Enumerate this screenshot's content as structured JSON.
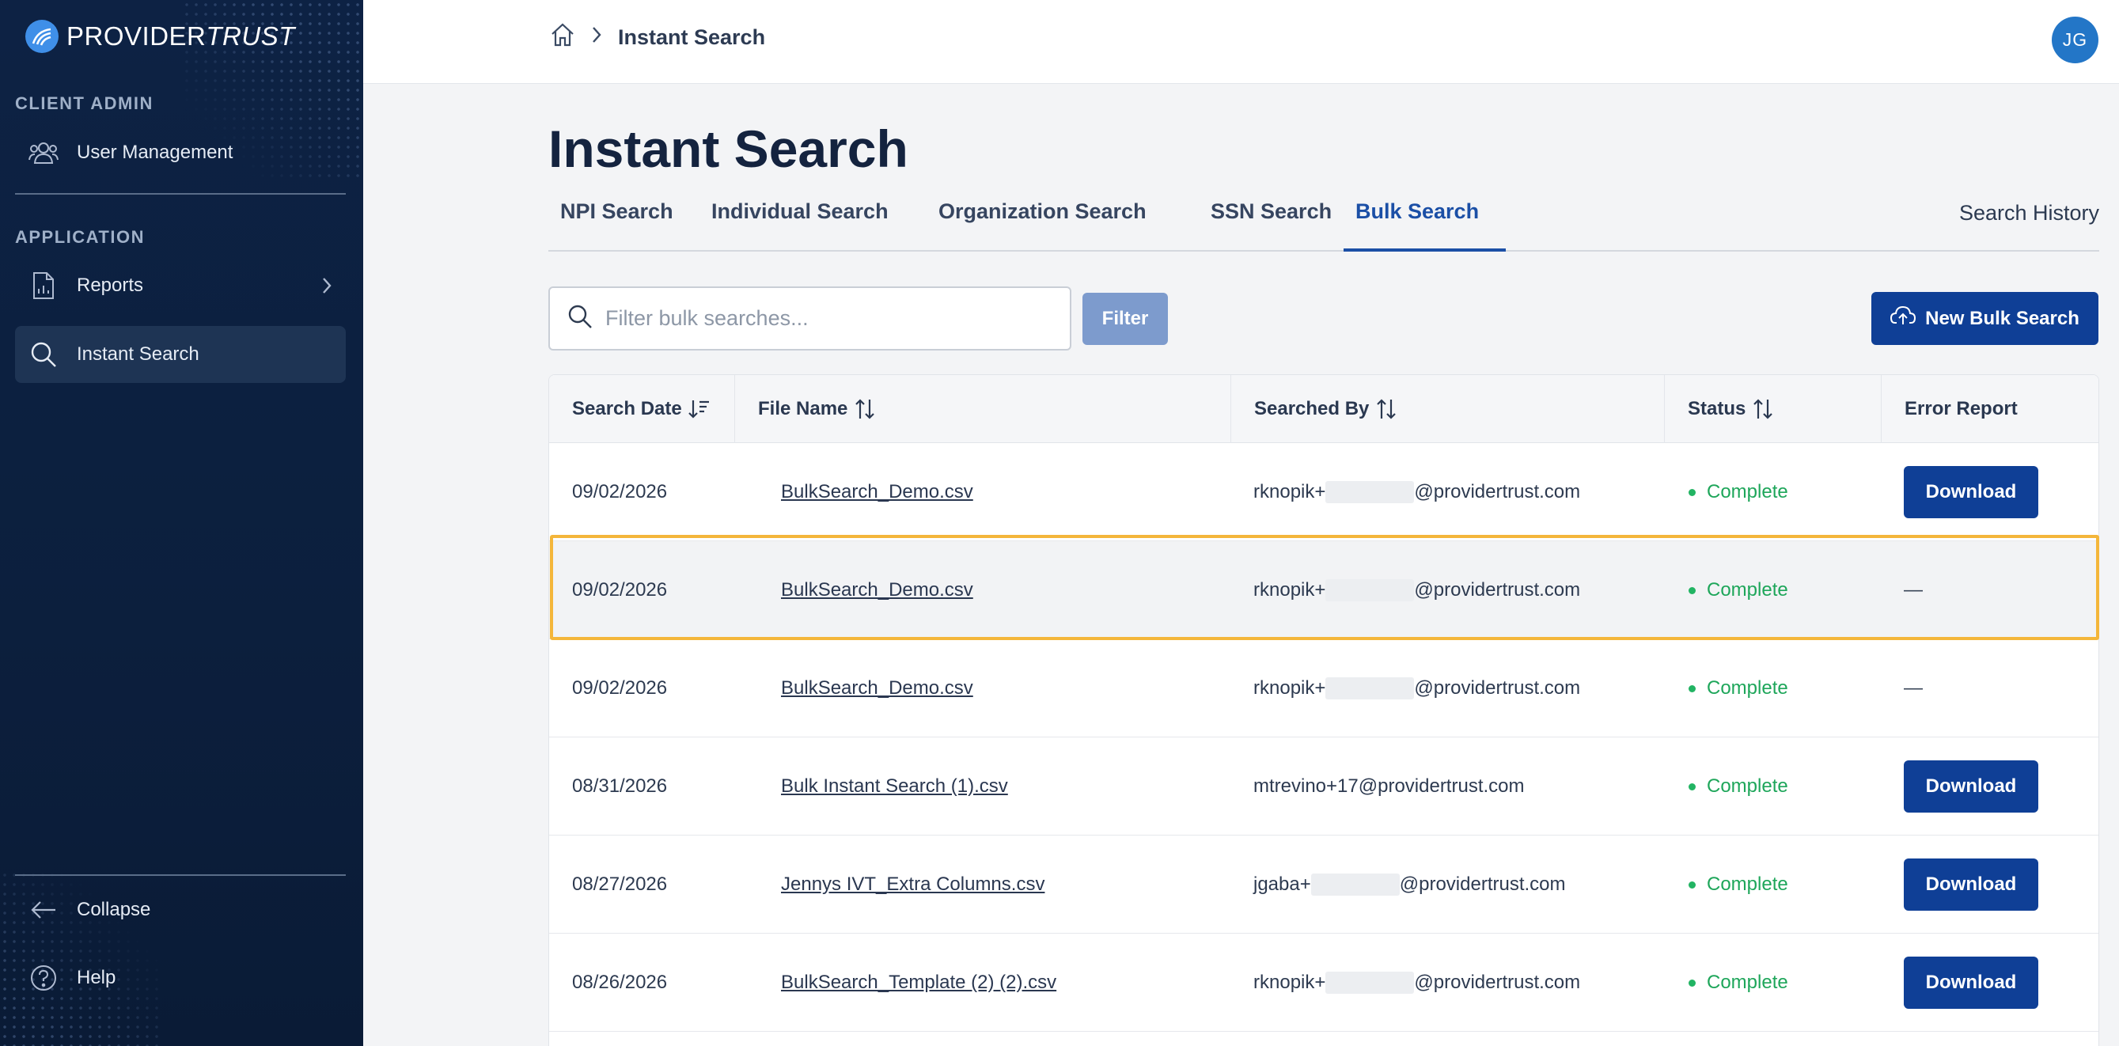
{
  "brand": {
    "name_bold": "PROVIDER",
    "name_light": "TRUST"
  },
  "sidebar": {
    "client_admin_heading": "CLIENT ADMIN",
    "user_management": "User Management",
    "application_heading": "APPLICATION",
    "reports": "Reports",
    "instant_search": "Instant Search",
    "collapse": "Collapse",
    "help": "Help"
  },
  "header": {
    "breadcrumb_current": "Instant Search",
    "avatar_initials": "JG"
  },
  "main": {
    "title": "Instant Search",
    "tabs": [
      "NPI Search",
      "Individual Search",
      "Organization Search",
      "SSN Search",
      "Bulk Search"
    ],
    "active_tab": "Bulk Search",
    "search_history": "Search History",
    "filter_placeholder": "Filter bulk searches...",
    "filter_button": "Filter",
    "new_bulk_button": "New Bulk Search"
  },
  "table": {
    "columns": [
      "Search Date",
      "File Name",
      "Searched By",
      "Status",
      "Error Report"
    ],
    "rows": [
      {
        "date": "09/02/2026",
        "file": "BulkSearch_Demo.csv",
        "by_prefix": "rknopik+",
        "by_suffix": "@providertrust.com",
        "redacted": true,
        "status": "Complete",
        "error": "Download"
      },
      {
        "date": "09/02/2026",
        "file": "BulkSearch_Demo.csv",
        "by_prefix": "rknopik+",
        "by_suffix": "@providertrust.com",
        "redacted": true,
        "status": "Complete",
        "error": "—"
      },
      {
        "date": "09/02/2026",
        "file": "BulkSearch_Demo.csv",
        "by_prefix": "rknopik+",
        "by_suffix": "@providertrust.com",
        "redacted": true,
        "status": "Complete",
        "error": "—"
      },
      {
        "date": "08/31/2026",
        "file": "Bulk Instant Search (1).csv",
        "by_prefix": "mtrevino+17@providertrust.com",
        "by_suffix": "",
        "redacted": false,
        "status": "Complete",
        "error": "Download"
      },
      {
        "date": "08/27/2026",
        "file": "Jennys IVT_Extra Columns.csv",
        "by_prefix": "jgaba+",
        "by_suffix": "@providertrust.com",
        "redacted": true,
        "status": "Complete",
        "error": "Download"
      },
      {
        "date": "08/26/2026",
        "file": "BulkSearch_Template (2) (2).csv",
        "by_prefix": "rknopik+",
        "by_suffix": "@providertrust.com",
        "redacted": true,
        "status": "Complete",
        "error": "Download"
      }
    ]
  },
  "colors": {
    "sidebar": "#0d2244",
    "primary_button": "#0f3f96",
    "filter_button": "#7d9bcd",
    "status_complete": "#1ea65a",
    "highlight": "#f4b63a",
    "active_tab": "#1b4fa6"
  },
  "icons": [
    "logo-icon",
    "users-icon",
    "report-icon",
    "chevron-right-icon",
    "search-icon",
    "arrow-left-icon",
    "help-icon",
    "home-icon",
    "cloud-upload-icon",
    "sort-icon"
  ]
}
